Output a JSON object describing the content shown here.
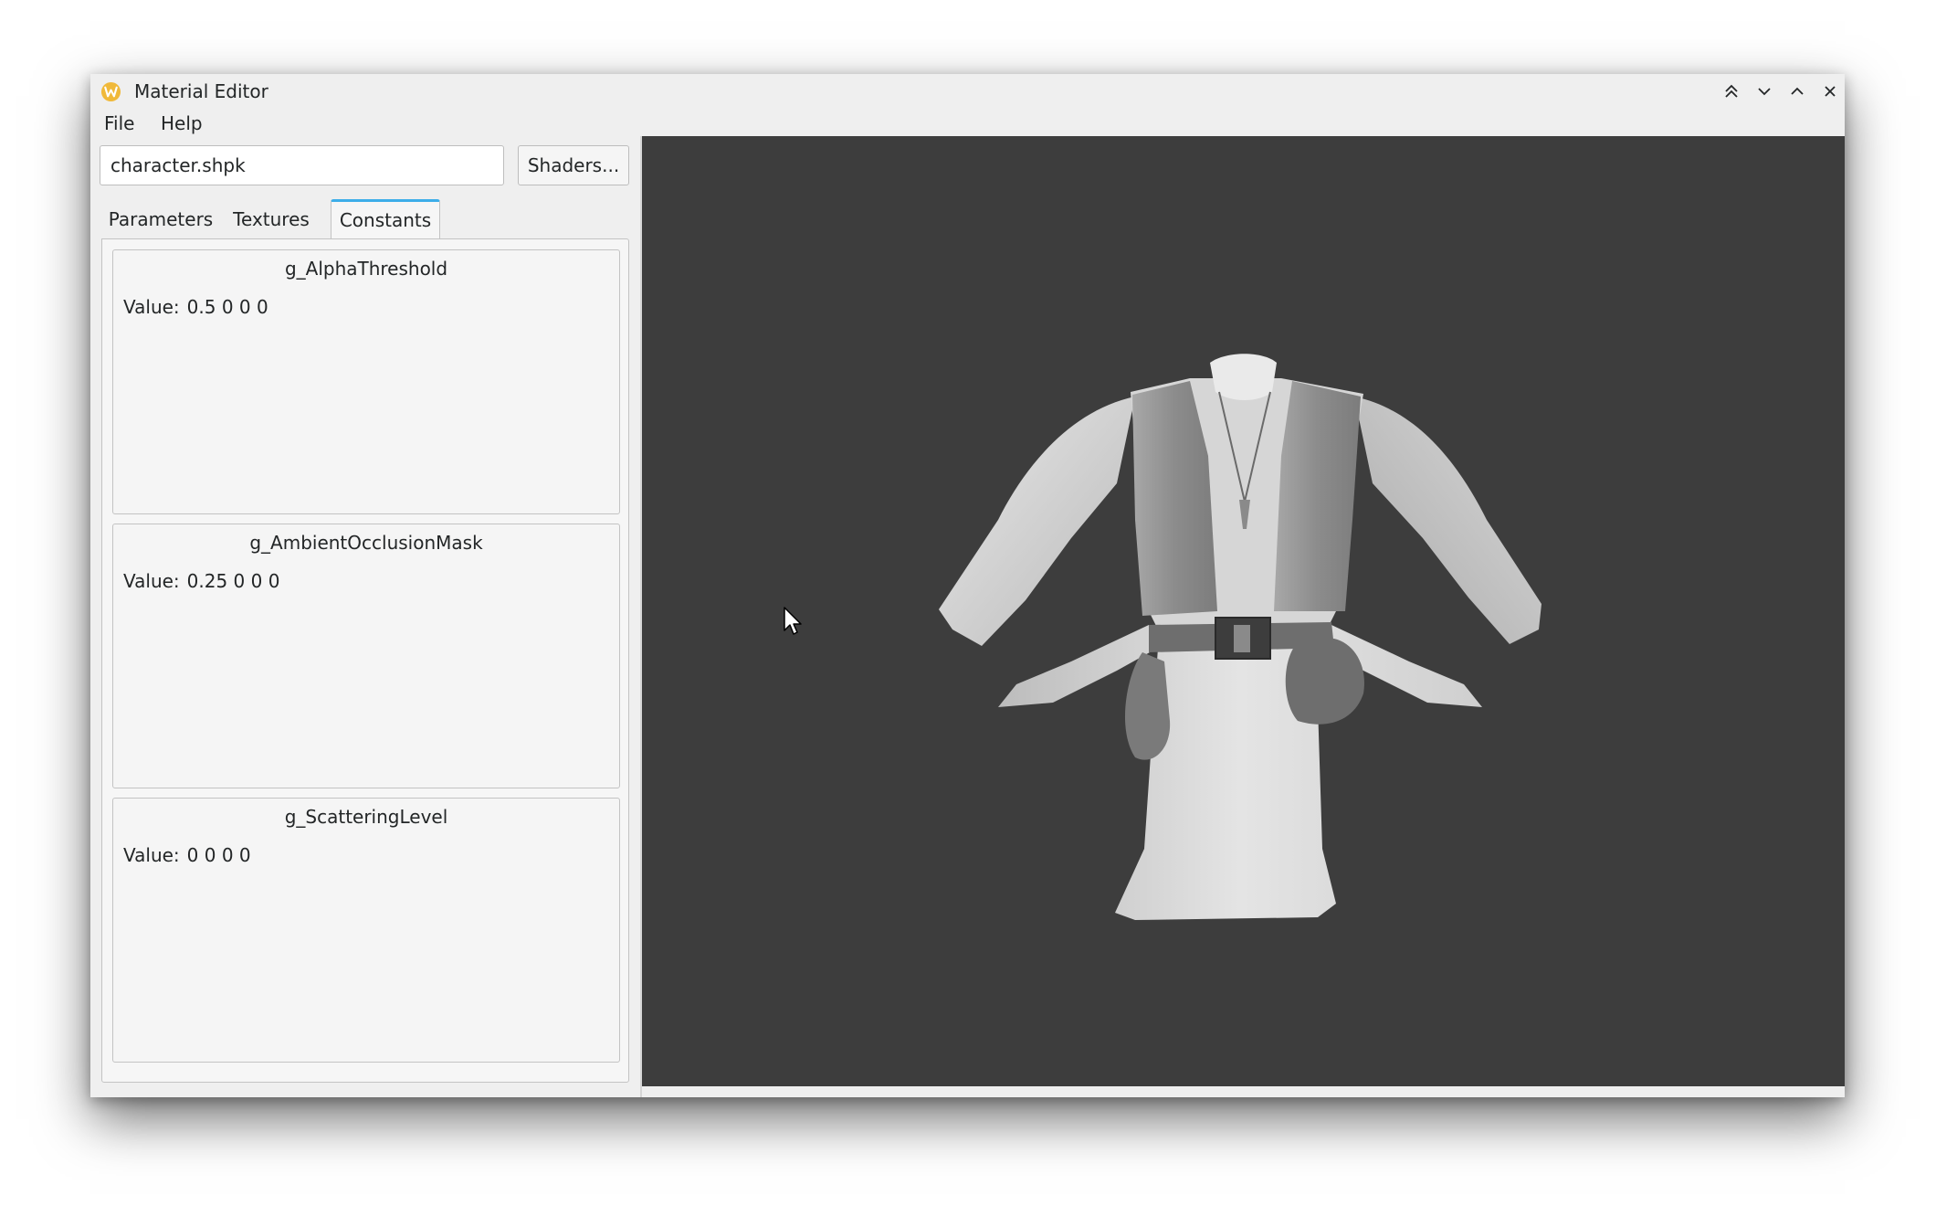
{
  "window": {
    "title": "Material Editor",
    "app_icon": "w-logo-icon",
    "controls": [
      "keep-above-icon",
      "minimize-icon",
      "maximize-icon",
      "close-icon"
    ]
  },
  "menu": {
    "file": "File",
    "help": "Help"
  },
  "shader": {
    "value": "character.shpk",
    "button_label": "Shaders..."
  },
  "tabs": [
    {
      "label": "Parameters",
      "active": false
    },
    {
      "label": "Textures",
      "active": false
    },
    {
      "label": "Constants",
      "active": true
    }
  ],
  "constants": [
    {
      "name": "g_AlphaThreshold",
      "value_label": "Value:",
      "value": "0.5 0 0 0"
    },
    {
      "name": "g_AmbientOcclusionMask",
      "value_label": "Value:",
      "value": "0.25 0 0 0"
    },
    {
      "name": "g_ScatteringLevel",
      "value_label": "Value:",
      "value": "0 0 0 0"
    }
  ],
  "colors": {
    "window_bg": "#efefef",
    "viewport_bg": "#3d3d3d",
    "accent": "#3daee9",
    "app_icon": "#f0b93a"
  }
}
